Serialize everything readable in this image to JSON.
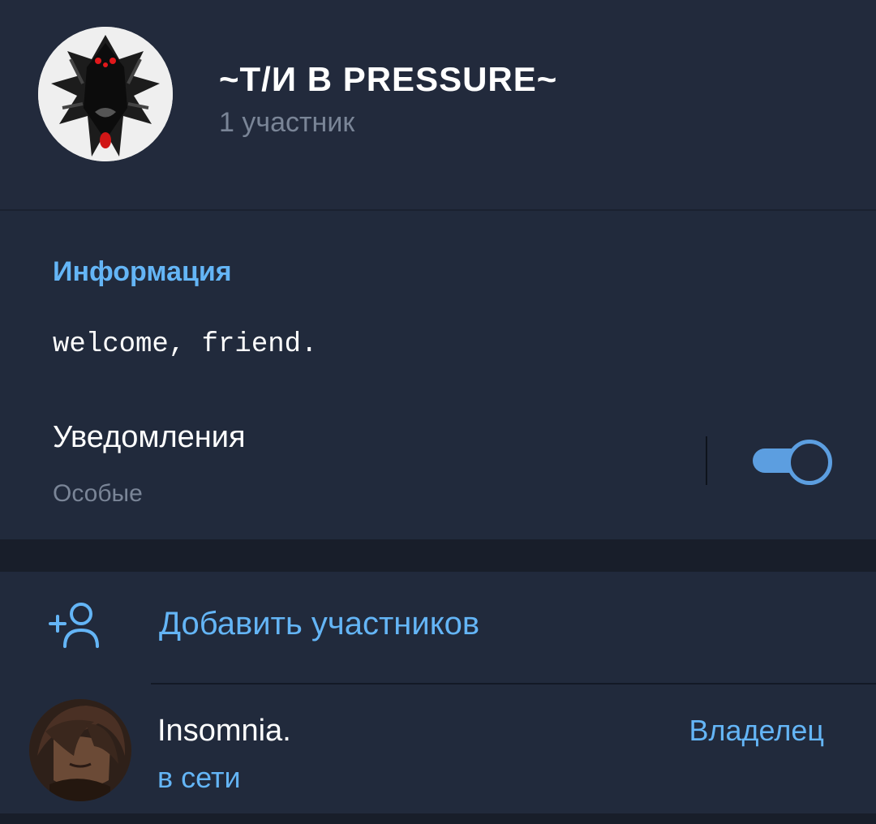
{
  "header": {
    "title": "~Т/И В PRESSURE~",
    "subtitle": "1 участник",
    "avatar_icon": "group-avatar-image"
  },
  "info": {
    "heading": "Информация",
    "description": "welcome, friend.",
    "notifications": {
      "label": "Уведомления",
      "value": "Особые",
      "enabled": true
    }
  },
  "members": {
    "add_label": "Добавить участников",
    "add_icon": "add-user-icon",
    "list": [
      {
        "name": "Insomnia.",
        "status": "в сети",
        "role": "Владелец"
      }
    ]
  },
  "colors": {
    "accent": "#64b5f6",
    "toggle": "#5c9ee0",
    "background": "#1a2130",
    "panel": "#212a3c",
    "muted_text": "#7a8597"
  }
}
